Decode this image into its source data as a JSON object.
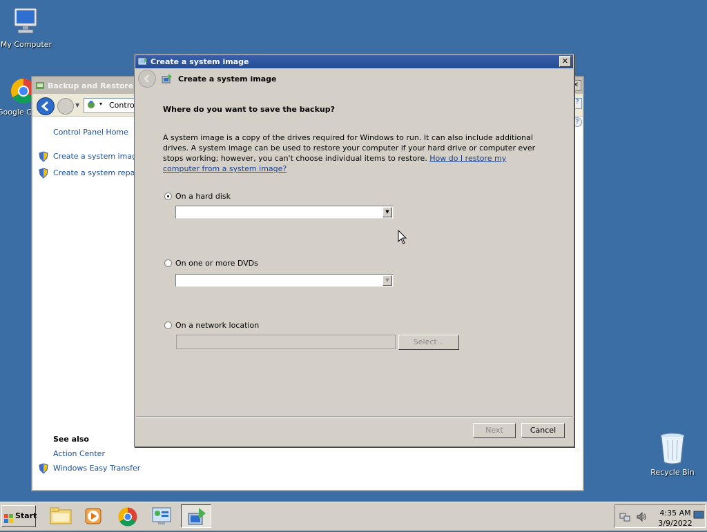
{
  "desktop": {
    "my_computer": "My Computer",
    "google_chrome": "Google C",
    "recycle_bin": "Recycle Bin"
  },
  "background_window": {
    "title": "Backup and Restore",
    "address": "Control",
    "sidebar": {
      "home": "Control Panel Home",
      "create_image": "Create a system image",
      "create_repair": "Create a system repair c",
      "see_also": "See also",
      "action_center": "Action Center",
      "easy_transfer": "Windows Easy Transfer"
    }
  },
  "dialog": {
    "title": "Create a system image",
    "wizard_title": "Create a system image",
    "heading": "Where do you want to save the backup?",
    "description": "A system image is a copy of the drives required for Windows to run. It can also include additional drives. A system image can be used to restore your computer if your hard drive or computer ever stops working; however, you can't choose individual items to restore. ",
    "help_link": "How do I restore my computer from a system image?",
    "options": {
      "hard_disk": "On a hard disk",
      "dvds": "On one or more DVDs",
      "network": "On a network location"
    },
    "select_button": "Select...",
    "next_button": "Next",
    "cancel_button": "Cancel",
    "close_glyph": "✕"
  },
  "taskbar": {
    "start": "Start",
    "time": "4:35 AM",
    "date": "3/9/2022"
  }
}
